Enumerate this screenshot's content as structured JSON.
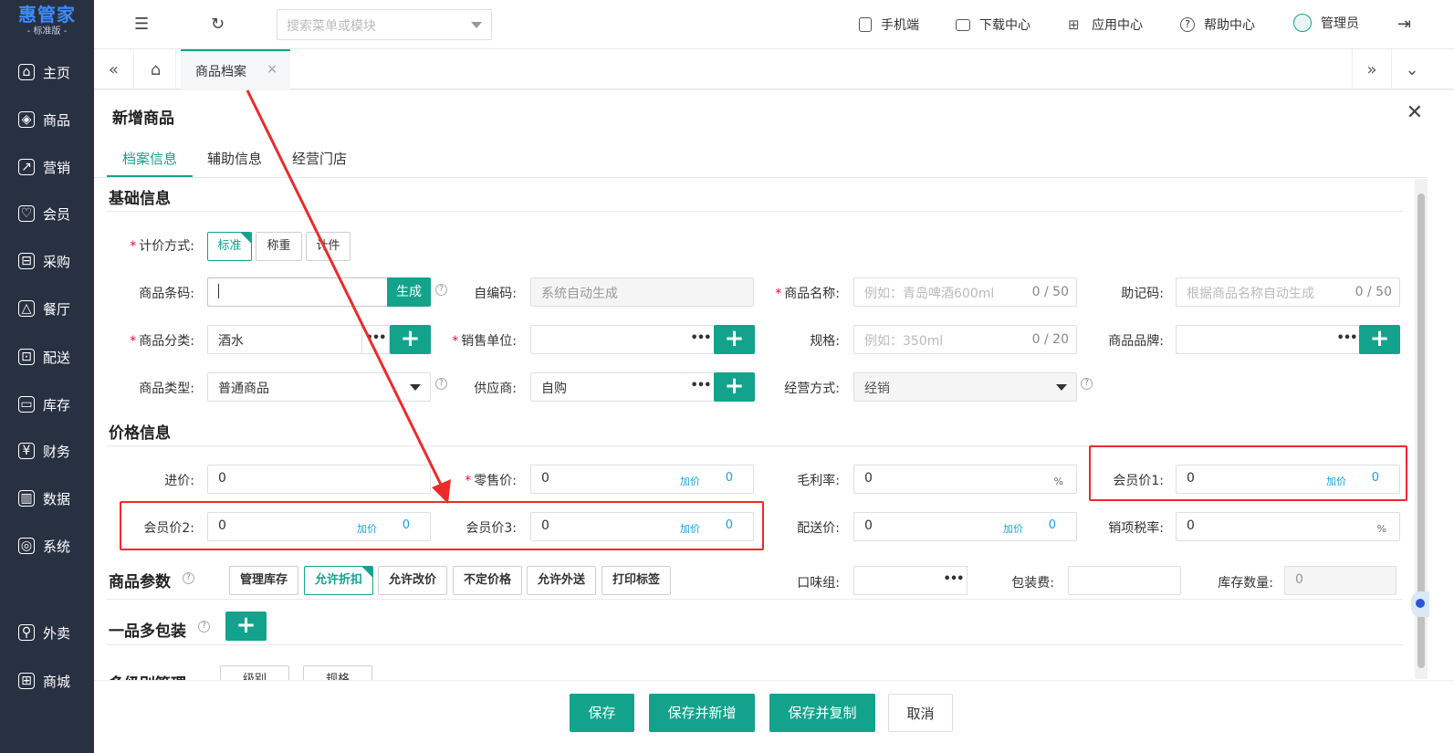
{
  "app": {
    "logo": "惠管家",
    "edition": "- 标准版 -"
  },
  "sidebar": {
    "items": [
      {
        "label": "主页",
        "icon": "home-icon",
        "glyph": "⌂"
      },
      {
        "label": "商品",
        "icon": "box-icon",
        "glyph": "◈"
      },
      {
        "label": "营销",
        "icon": "chart-icon",
        "glyph": "↗"
      },
      {
        "label": "会员",
        "icon": "heart-icon",
        "glyph": "♡"
      },
      {
        "label": "采购",
        "icon": "cart-icon",
        "glyph": "⊟"
      },
      {
        "label": "餐厅",
        "icon": "dish-icon",
        "glyph": "△"
      },
      {
        "label": "配送",
        "icon": "truck-icon",
        "glyph": "⊡"
      },
      {
        "label": "库存",
        "icon": "warehouse-icon",
        "glyph": "▭"
      },
      {
        "label": "财务",
        "icon": "money-icon",
        "glyph": "¥"
      },
      {
        "label": "数据",
        "icon": "data-icon",
        "glyph": "▥"
      },
      {
        "label": "系统",
        "icon": "settings-icon",
        "glyph": "◎"
      },
      {
        "label": "外卖",
        "icon": "bike-icon",
        "glyph": "⚲"
      },
      {
        "label": "商城",
        "icon": "shop-icon",
        "glyph": "⊞"
      }
    ]
  },
  "topbar": {
    "search_placeholder": "搜索菜单或模块",
    "mobile": "手机端",
    "download": "下载中心",
    "apps": "应用中心",
    "help": "帮助中心",
    "user": "管理员"
  },
  "tabs": {
    "active": "商品档案"
  },
  "panel": {
    "title": "新增商品",
    "subtabs": [
      "档案信息",
      "辅助信息",
      "经营门店"
    ]
  },
  "sections": {
    "basic": "基础信息",
    "price": "价格信息",
    "params": "商品参数",
    "multipack": "一品多包装",
    "multilevel": "多级别管理"
  },
  "basic": {
    "pricing_label": "计价方式:",
    "pricing_options": [
      "标准",
      "称重",
      "计件"
    ],
    "pricing_selected": "标准",
    "barcode_label": "商品条码:",
    "barcode_value": "",
    "generate": "生成",
    "selfcode_label": "自编码:",
    "selfcode_placeholder": "系统自动生成",
    "name_label": "商品名称:",
    "name_placeholder": "例如：青岛啤酒600ml",
    "name_count": "0 / 50",
    "mnemonic_label": "助记码:",
    "mnemonic_placeholder": "根据商品名称自动生成",
    "mnemonic_count": "0 / 50",
    "category_label": "商品分类:",
    "category_value": "酒水",
    "unit_label": "销售单位:",
    "unit_value": "",
    "spec_label": "规格:",
    "spec_placeholder": "例如：350ml",
    "spec_count": "0 / 20",
    "brand_label": "商品品牌:",
    "brand_value": "",
    "type_label": "商品类型:",
    "type_value": "普通商品",
    "supplier_label": "供应商:",
    "supplier_value": "自购",
    "mode_label": "经营方式:",
    "mode_value": "经销"
  },
  "price": {
    "cost_label": "进价:",
    "cost": "0",
    "retail_label": "零售价:",
    "retail": "0",
    "margin_label": "毛利率:",
    "margin": "0",
    "pct": "%",
    "member1_label": "会员价1:",
    "member1": "0",
    "member2_label": "会员价2:",
    "member2": "0",
    "member3_label": "会员价3:",
    "member3": "0",
    "delivery_label": "配送价:",
    "delivery": "0",
    "tax_label": "销项税率:",
    "tax": "0",
    "add_label": "加价",
    "add_value": "0"
  },
  "params": {
    "toggles": [
      "管理库存",
      "允许折扣",
      "允许改价",
      "不定价格",
      "允许外送",
      "打印标签"
    ],
    "selected": "允许折扣",
    "flavor_label": "口味组:",
    "flavor_value": "",
    "pack_fee_label": "包装费:",
    "pack_fee": "",
    "stock_label": "库存数量:",
    "stock": "0"
  },
  "multilevel": {
    "buttons": [
      "级别",
      "规格"
    ]
  },
  "footer": {
    "save": "保存",
    "save_new": "保存并新增",
    "save_copy": "保存并复制",
    "cancel": "取消"
  },
  "colors": {
    "accent": "#13a38c",
    "sidebar": "#283142",
    "annotation": "#ee2a2a"
  }
}
